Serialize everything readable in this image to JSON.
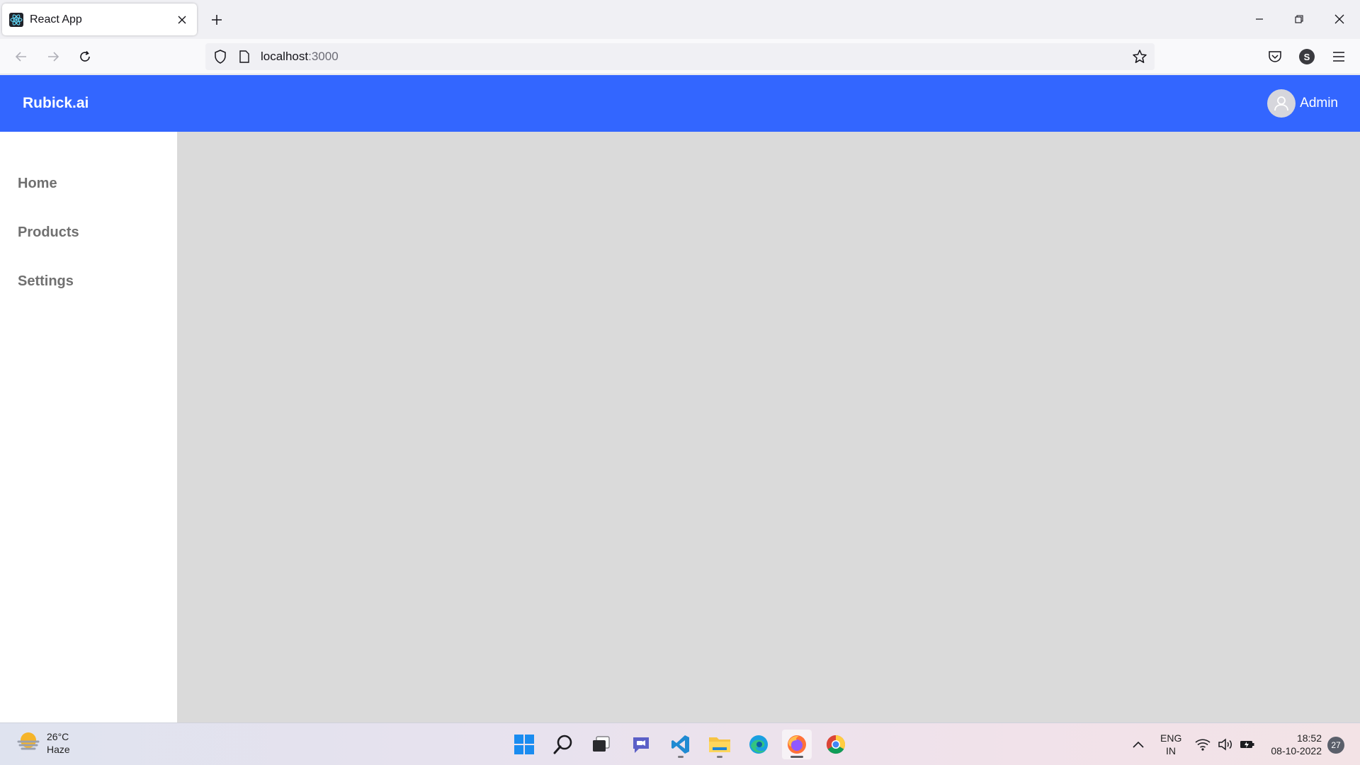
{
  "browser": {
    "tab_title": "React App",
    "url_host": "localhost",
    "url_port": ":3000",
    "profile_initial": "S"
  },
  "app": {
    "brand": "Rubick.ai",
    "user_name": "Admin",
    "accent_color": "#3366ff",
    "nav": [
      {
        "label": "Home"
      },
      {
        "label": "Products"
      },
      {
        "label": "Settings"
      }
    ]
  },
  "taskbar": {
    "weather_temp": "26°C",
    "weather_desc": "Haze",
    "lang_primary": "ENG",
    "lang_region": "IN",
    "time": "18:52",
    "date": "08-10-2022",
    "notification_count": "27",
    "pinned_apps": [
      "windows-start-icon",
      "search-icon",
      "task-view-icon",
      "teams-chat-icon",
      "vscode-icon",
      "file-explorer-icon",
      "edge-icon",
      "firefox-icon",
      "chrome-icon"
    ]
  }
}
